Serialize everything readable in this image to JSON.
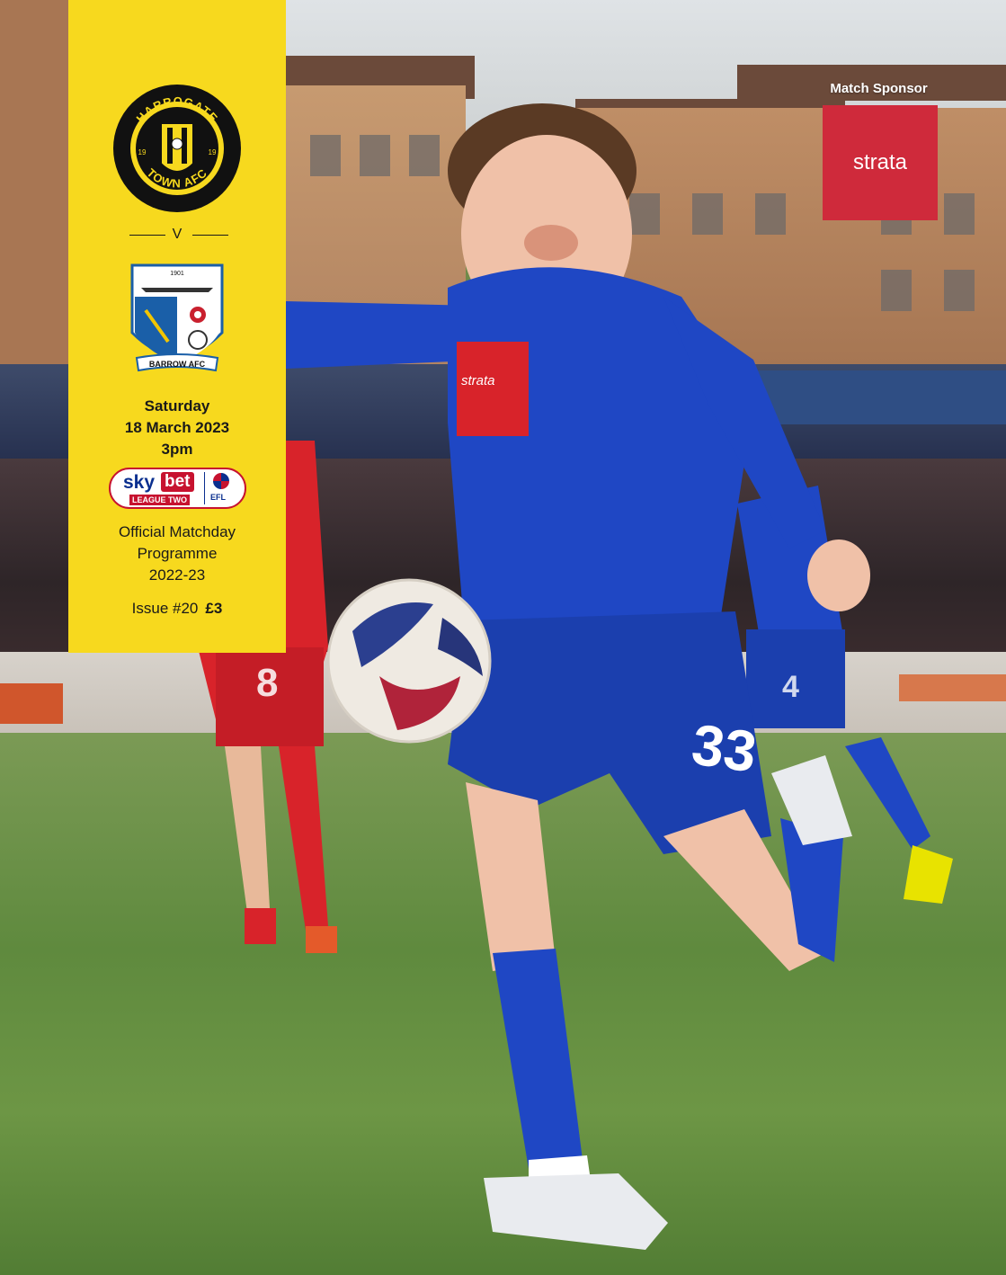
{
  "home_team": {
    "name": "HARROGATE TOWN AFC",
    "ring_top": "HARROGATE",
    "ring_bottom": "TOWN AFC",
    "founded_left": "19",
    "founded_right": "19"
  },
  "separator": "V",
  "away_team": {
    "name": "BARROW AFC",
    "year": "1901",
    "banner": "BARROW AFC"
  },
  "match": {
    "day": "Saturday",
    "date": "18 March 2023",
    "time": "3pm"
  },
  "competition": {
    "sky": "sky",
    "bet": "bet",
    "league": "LEAGUE TWO",
    "efl": "EFL"
  },
  "programme": {
    "line1": "Official Matchday",
    "line2": "Programme",
    "season": "2022-23"
  },
  "issue": {
    "label": "Issue #20",
    "price": "£3"
  },
  "sponsor": {
    "label": "Match Sponsor",
    "name": "strata"
  },
  "photo": {
    "shirt_sponsor": "strata",
    "shirt_number": "33",
    "opponent_number": "8",
    "opponent_number2": "4"
  },
  "colors": {
    "panel": "#f7d91e",
    "sponsor": "#cf2a3b",
    "home_kit": "#1f47c4",
    "away_kit": "#d8232a"
  }
}
